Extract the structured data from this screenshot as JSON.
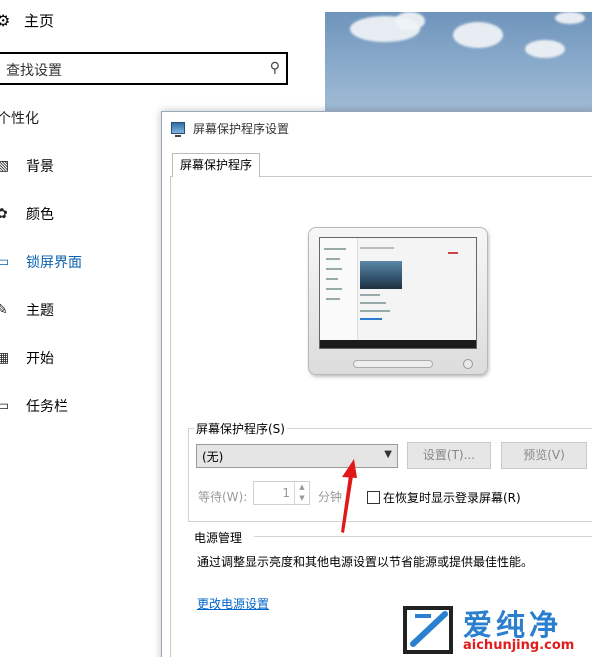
{
  "settings": {
    "home_label": "主页",
    "search_placeholder": "查找设置",
    "section_title": "个性化",
    "nav": [
      {
        "label": "背景",
        "icon": "picture-icon"
      },
      {
        "label": "颜色",
        "icon": "palette-icon"
      },
      {
        "label": "锁屏界面",
        "icon": "lock-screen-icon",
        "active": true
      },
      {
        "label": "主题",
        "icon": "theme-brush-icon"
      },
      {
        "label": "开始",
        "icon": "start-grid-icon"
      },
      {
        "label": "任务栏",
        "icon": "taskbar-icon"
      }
    ],
    "accent_color": "#0a62b0"
  },
  "dialog": {
    "title": "屏幕保护程序设置",
    "tab_label": "屏幕保护程序",
    "screensaver_group_label": "屏幕保护程序(S)",
    "screensaver_value": "(无)",
    "settings_button": "设置(T)...",
    "preview_button": "预览(V)",
    "wait_label": "等待(W):",
    "wait_value": "1",
    "minute_label": "分钟",
    "resume_checkbox_label": "在恢复时显示登录屏幕(R)",
    "resume_checked": false,
    "power_title": "电源管理",
    "power_description": "通过调整显示亮度和其他电源设置以节省能源或提供最佳性能。",
    "power_link": "更改电源设置"
  },
  "watermark": {
    "cn_text": "爱纯净",
    "url": "aichunjing.com",
    "color": "#2b7fcf"
  }
}
